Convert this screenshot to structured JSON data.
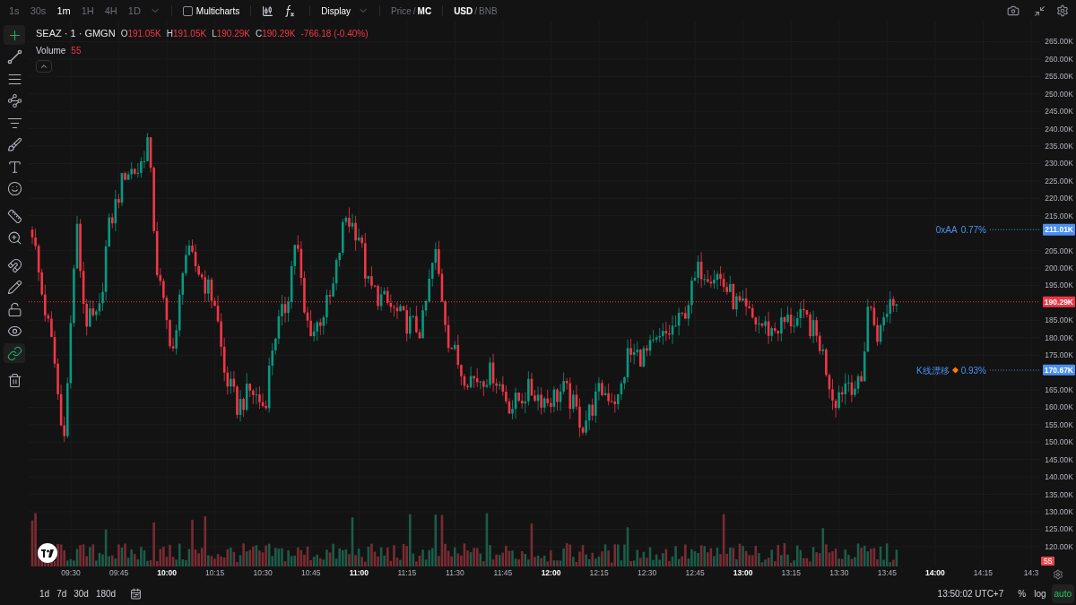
{
  "toolbar": {
    "intervals": [
      {
        "label": "1s",
        "selected": false
      },
      {
        "label": "30s",
        "selected": false
      },
      {
        "label": "1m",
        "selected": true
      },
      {
        "label": "1H",
        "selected": false
      },
      {
        "label": "4H",
        "selected": false
      },
      {
        "label": "1D",
        "selected": false
      }
    ],
    "multicharts": {
      "label": "Multicharts",
      "checked": false
    },
    "display": "Display",
    "separator": "/",
    "price_toggle": [
      {
        "label": "Price",
        "selected": false
      },
      {
        "label": "MC",
        "selected": true
      }
    ],
    "currency_toggle": [
      {
        "label": "USD",
        "selected": true
      },
      {
        "label": "BNB",
        "selected": false
      }
    ]
  },
  "tools": [
    {
      "kind": "crosshair",
      "selected": true
    },
    {
      "kind": "line",
      "selected": false
    },
    {
      "kind": "hlines",
      "selected": false
    },
    {
      "kind": "pattern",
      "selected": false
    },
    {
      "kind": "fib",
      "selected": false
    },
    {
      "kind": "brush",
      "selected": false
    },
    {
      "kind": "text",
      "selected": false
    },
    {
      "kind": "emoji",
      "selected": false
    },
    {
      "kind": "ruler",
      "selected": false
    },
    {
      "kind": "zoom",
      "selected": false
    },
    {
      "kind": "magnet",
      "selected": false
    },
    {
      "kind": "pencil",
      "selected": false
    },
    {
      "kind": "lock",
      "selected": false
    },
    {
      "kind": "eye",
      "selected": false
    },
    {
      "kind": "link",
      "selected": true
    },
    {
      "kind": "trash",
      "selected": false
    }
  ],
  "legend": {
    "symbol": "SEAZ · 1 · GMGN",
    "ohlc": [
      {
        "label": "O",
        "value": "191.05K"
      },
      {
        "label": "H",
        "value": "191.05K"
      },
      {
        "label": "L",
        "value": "190.29K"
      },
      {
        "label": "C",
        "value": "190.29K"
      }
    ],
    "change": "-766.18 (-0.40%)",
    "volume_label": "Volume",
    "volume_value": "55"
  },
  "price_axis": {
    "ticks": [
      "265.00K",
      "260.00K",
      "255.00K",
      "250.00K",
      "245.00K",
      "240.00K",
      "235.00K",
      "230.00K",
      "225.00K",
      "220.00K",
      "215.00K",
      "205.00K",
      "200.00K",
      "195.00K",
      "185.00K",
      "180.00K",
      "175.00K",
      "165.00K",
      "160.00K",
      "155.00K",
      "150.00K",
      "145.00K",
      "140.00K",
      "135.00K",
      "130.00K",
      "125.00K",
      "120.00K"
    ],
    "last_price": "190.29K",
    "volume_badge": "55"
  },
  "markers": [
    {
      "label": "0xAA",
      "value": "0.77%",
      "price": "211.01K",
      "kind": "plain"
    },
    {
      "label": "K线漂移",
      "value": "0.93%",
      "price": "170.67K",
      "kind": "flagged"
    }
  ],
  "time_axis": [
    {
      "label": "09:30",
      "bold": false
    },
    {
      "label": "09:45",
      "bold": false
    },
    {
      "label": "10:00",
      "bold": true
    },
    {
      "label": "10:15",
      "bold": false
    },
    {
      "label": "10:30",
      "bold": false
    },
    {
      "label": "10:45",
      "bold": false
    },
    {
      "label": "11:00",
      "bold": true
    },
    {
      "label": "11:15",
      "bold": false
    },
    {
      "label": "11:30",
      "bold": false
    },
    {
      "label": "11:45",
      "bold": false
    },
    {
      "label": "12:00",
      "bold": true
    },
    {
      "label": "12:15",
      "bold": false
    },
    {
      "label": "12:30",
      "bold": false
    },
    {
      "label": "12:45",
      "bold": false
    },
    {
      "label": "13:00",
      "bold": true
    },
    {
      "label": "13:15",
      "bold": false
    },
    {
      "label": "13:30",
      "bold": false
    },
    {
      "label": "13:45",
      "bold": false
    },
    {
      "label": "14:00",
      "bold": true
    },
    {
      "label": "14:15",
      "bold": false
    },
    {
      "label": "14:3",
      "bold": false
    }
  ],
  "bottom": {
    "ranges": [
      "1d",
      "7d",
      "30d",
      "180d"
    ],
    "clock": "13:50:02 UTC+7",
    "scale_buttons": [
      {
        "label": "%",
        "selected": false
      },
      {
        "label": "log",
        "selected": false
      },
      {
        "label": "auto",
        "selected": true
      }
    ]
  }
}
